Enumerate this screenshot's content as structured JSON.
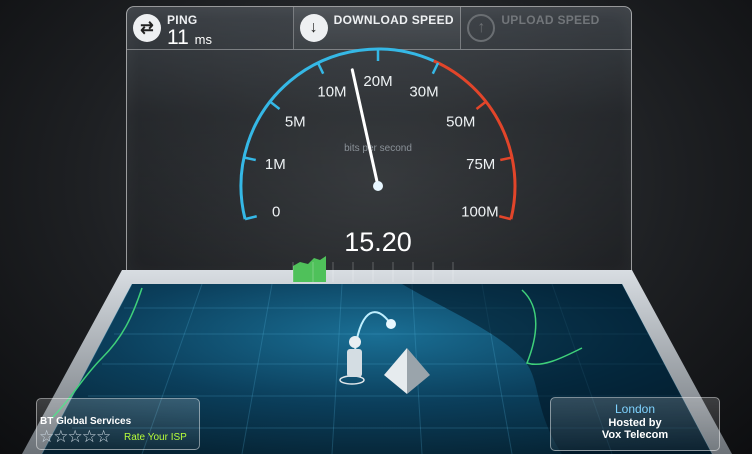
{
  "stats": {
    "ping": {
      "label": "PING",
      "value": "11",
      "unit": "ms",
      "icon": "ping-arrows-icon"
    },
    "download": {
      "label": "DOWNLOAD SPEED",
      "icon": "download-arrow-icon"
    },
    "upload": {
      "label": "UPLOAD SPEED",
      "icon": "upload-arrow-icon"
    }
  },
  "gauge": {
    "unit_label": "bits per second",
    "value": "15.20",
    "needle_value_mbps": 15.2,
    "scale_labels": [
      "0",
      "1M",
      "5M",
      "10M",
      "20M",
      "30M",
      "50M",
      "75M",
      "100M"
    ],
    "colors": {
      "normal": "#35b8e6",
      "high": "#e2452a",
      "history": "#4fc15a"
    }
  },
  "isp": {
    "name": "BT Global Services",
    "rating_stars": 5,
    "rate_label": "Rate Your ISP"
  },
  "server": {
    "city": "London",
    "hosted_line1": "Hosted by",
    "hosted_line2": "Vox Telecom"
  }
}
